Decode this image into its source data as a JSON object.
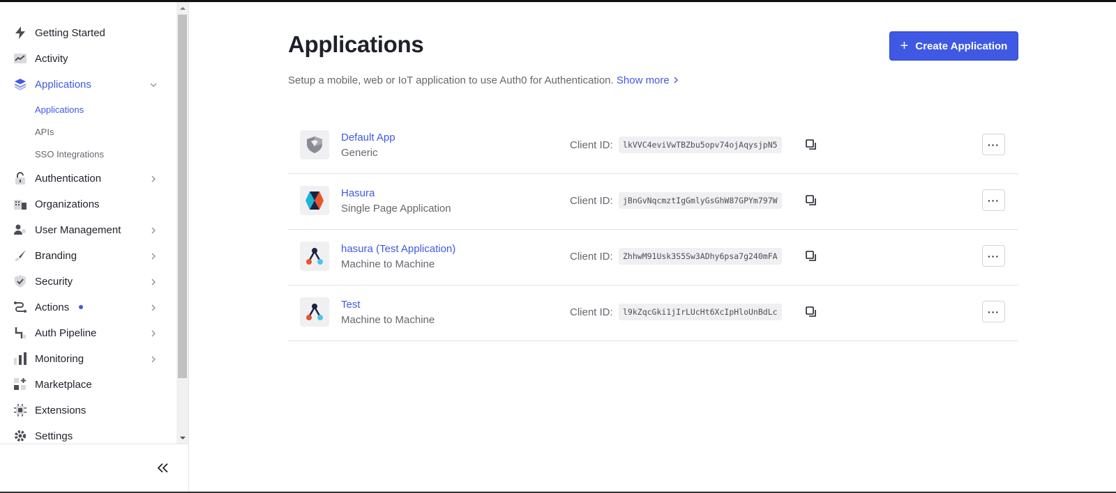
{
  "sidebar": {
    "items": [
      {
        "label": "Getting Started",
        "icon": "lightning-icon"
      },
      {
        "label": "Activity",
        "icon": "activity-chart-icon"
      },
      {
        "label": "Applications",
        "icon": "layers-icon"
      },
      {
        "label": "Authentication",
        "icon": "lock-icon"
      },
      {
        "label": "Organizations",
        "icon": "building-icon"
      },
      {
        "label": "User Management",
        "icon": "user-gear-icon"
      },
      {
        "label": "Branding",
        "icon": "brush-icon"
      },
      {
        "label": "Security",
        "icon": "shield-check-icon"
      },
      {
        "label": "Actions",
        "icon": "flow-icon"
      },
      {
        "label": "Auth Pipeline",
        "icon": "pipeline-icon"
      },
      {
        "label": "Monitoring",
        "icon": "bar-chart-icon"
      },
      {
        "label": "Marketplace",
        "icon": "grid-plus-icon"
      },
      {
        "label": "Extensions",
        "icon": "chip-icon"
      },
      {
        "label": "Settings",
        "icon": "gear-icon"
      }
    ],
    "sub_items": [
      {
        "label": "Applications"
      },
      {
        "label": "APIs"
      },
      {
        "label": "SSO Integrations"
      }
    ],
    "collapse_label": "«"
  },
  "main": {
    "title": "Applications",
    "create_button": "Create Application",
    "description": "Setup a mobile, web or IoT application to use Auth0 for Authentication.",
    "show_more": "Show more",
    "client_id_label": "Client ID:",
    "more_label": "···",
    "apps": [
      {
        "name": "Default App",
        "type": "Generic",
        "client_id": "lkVVC4eviVwTBZbu5opv74ojAqysjpN5",
        "logo": "shield-logo-icon"
      },
      {
        "name": "Hasura",
        "type": "Single Page Application",
        "client_id": "jBnGvNqcmztIgGmlyGsGhW87GPYm797W",
        "logo": "hasura-logo-icon"
      },
      {
        "name": "hasura (Test Application)",
        "type": "Machine to Machine",
        "client_id": "ZhhwM91Usk3S5Sw3ADhy6psa7g240mFA",
        "logo": "m2m-logo-icon"
      },
      {
        "name": "Test",
        "type": "Machine to Machine",
        "client_id": "l9kZqcGki1jIrLUcHt6XcIpHloUnBdLc",
        "logo": "m2m-logo-icon"
      }
    ]
  },
  "colors": {
    "accent": "#3f59e4",
    "text": "#1e212a",
    "muted": "#65676e"
  }
}
